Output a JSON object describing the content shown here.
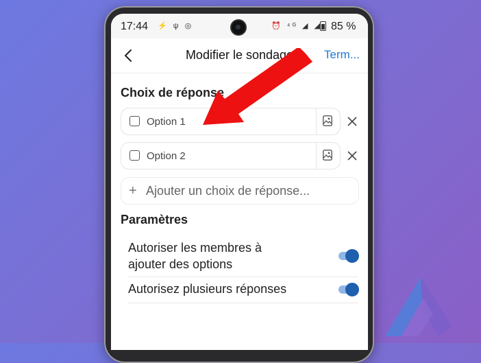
{
  "status": {
    "time": "17:44",
    "left_icons": "⚡ ψ ◎",
    "right_icons": "⏰ ⁴ᴳ ◢ ◢",
    "battery": "85 %"
  },
  "header": {
    "title": "Modifier le sondage",
    "done_label": "Term..."
  },
  "choices": {
    "title": "Choix de réponse",
    "options": [
      {
        "label": "Option 1"
      },
      {
        "label": "Option 2"
      }
    ],
    "add_label": "Ajouter un choix de réponse..."
  },
  "settings": {
    "title": "Paramètres",
    "items": [
      {
        "label_line1": "Autoriser les membres à",
        "label_line2": "ajouter des options",
        "enabled": true
      },
      {
        "label_line1": "Autorisez plusieurs réponses",
        "enabled": true
      }
    ]
  },
  "colors": {
    "accent": "#1f7bd8",
    "toggle_on": "#1e5fae",
    "arrow": "#ee1111"
  },
  "icons": [
    "back-arrow-icon",
    "checkbox-icon",
    "image-icon",
    "close-icon",
    "plus-icon"
  ]
}
